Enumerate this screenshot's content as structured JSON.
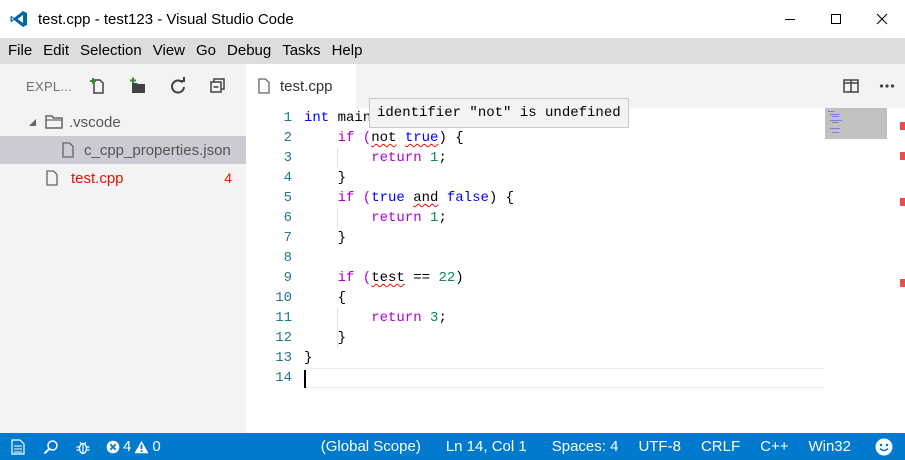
{
  "window": {
    "title": "test.cpp - test123 - Visual Studio Code",
    "controls": [
      "minimize-icon",
      "maximize-icon",
      "close-icon"
    ]
  },
  "menu": [
    "File",
    "Edit",
    "Selection",
    "View",
    "Go",
    "Debug",
    "Tasks",
    "Help"
  ],
  "sidebar": {
    "title": "EXPL...",
    "tools": [
      "new-file-icon",
      "new-folder-icon",
      "refresh-icon",
      "collapse-all-icon"
    ],
    "tree": [
      {
        "label": ".vscode",
        "type": "folder"
      },
      {
        "label": "c_cpp_properties.json",
        "type": "file"
      },
      {
        "label": "test.cpp",
        "type": "file",
        "errors": "4"
      }
    ]
  },
  "tab": {
    "label": "test.cpp"
  },
  "editor": {
    "line_numbers": [
      "1",
      "2",
      "3",
      "4",
      "5",
      "6",
      "7",
      "8",
      "9",
      "10",
      "11",
      "12",
      "13",
      "14"
    ],
    "hover": "identifier \"not\" is undefined",
    "tokens": {
      "l1_int": "int",
      "l1_main": " main",
      "l2_a": "    if (",
      "l2_not": "not",
      "l2_sp": " ",
      "l2_true": "true",
      "l2_b": ") {",
      "ret_indent": "        ",
      "return": "return",
      "one": "1",
      "three": "3",
      "semi": ";",
      "close4": "    }",
      "l5_a": "    if (",
      "l5_true": "true",
      "l5_sp": " ",
      "l5_and": "and",
      "l5_false": "false",
      "l5_b": ") {",
      "l9_a": "    if (",
      "l9_test": "test",
      "l9_b": " == ",
      "l9_num": "22",
      "l9_c": ")",
      "l10": "    {",
      "l13": "}"
    }
  },
  "status": {
    "problems_errors": "4",
    "problems_warnings": "0",
    "scope": "(Global Scope)",
    "position": "Ln 14, Col 1",
    "spaces": "Spaces: 4",
    "encoding": "UTF-8",
    "eol": "CRLF",
    "language": "C++",
    "platform": "Win32"
  },
  "colors": {
    "statusbar": "#007acc",
    "keyword": "#0000ff",
    "control": "#af00db",
    "number": "#09885a",
    "error": "#e51400"
  }
}
